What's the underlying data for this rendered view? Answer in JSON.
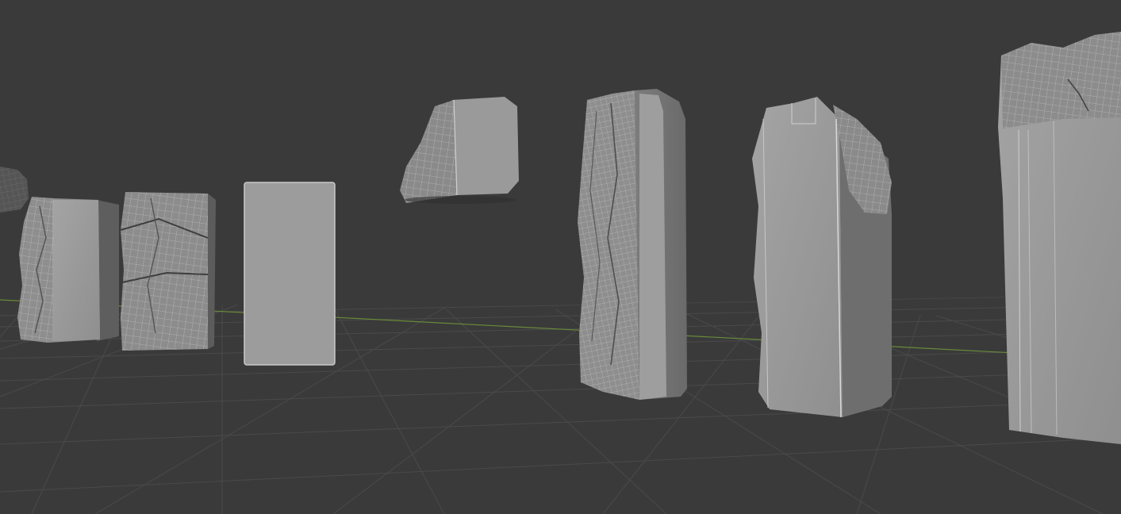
{
  "viewport": {
    "name": "3D Viewport",
    "background_color": "#3a3a3a",
    "grid_color": "#4a4a4a",
    "x_axis_color": "#6a8a3a",
    "mesh_color": "#9a9a9a",
    "wire_color": "#d8d8d8"
  },
  "objects": [
    {
      "name": "rock-fragment-far-left"
    },
    {
      "name": "pillar-rough-small"
    },
    {
      "name": "pillar-cracked-block"
    },
    {
      "name": "pillar-smooth-plane"
    },
    {
      "name": "floating-rock-chunk"
    },
    {
      "name": "pillar-tall-rough"
    },
    {
      "name": "pillar-half-rough"
    },
    {
      "name": "pillar-large-partial"
    }
  ]
}
